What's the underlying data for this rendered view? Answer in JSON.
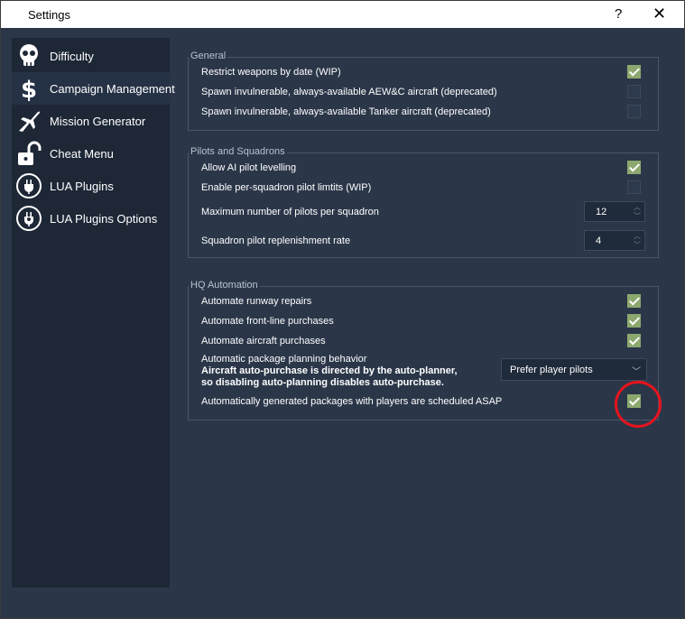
{
  "window": {
    "title": "Settings",
    "help_label": "?",
    "close_label": "✕"
  },
  "sidebar": {
    "items": [
      {
        "label": "Difficulty",
        "icon": "skull-icon"
      },
      {
        "label": "Campaign Management",
        "icon": "dollar-icon"
      },
      {
        "label": "Mission Generator",
        "icon": "jet-icon"
      },
      {
        "label": "Cheat Menu",
        "icon": "unlock-icon"
      },
      {
        "label": "LUA Plugins",
        "icon": "plug-icon"
      },
      {
        "label": "LUA Plugins Options",
        "icon": "plug-settings-icon"
      }
    ],
    "selected_index": 1
  },
  "general": {
    "title": "General",
    "rows": [
      {
        "label": "Restrict weapons by date (WIP)",
        "checked": true
      },
      {
        "label": "Spawn invulnerable, always-available AEW&C aircraft (deprecated)",
        "checked": false
      },
      {
        "label": "Spawn invulnerable, always-available Tanker aircraft (deprecated)",
        "checked": false
      }
    ]
  },
  "pilots": {
    "title": "Pilots and Squadrons",
    "rows": [
      {
        "label": "Allow AI pilot levelling",
        "checked": true
      },
      {
        "label": "Enable per-squadron pilot limtits (WIP)",
        "checked": false
      }
    ],
    "max_pilots": {
      "label": "Maximum number of pilots per squadron",
      "value": "12"
    },
    "replenish": {
      "label": "Squadron pilot replenishment rate",
      "value": "4"
    }
  },
  "hq": {
    "title": "HQ Automation",
    "rows": [
      {
        "label": "Automate runway repairs",
        "checked": true
      },
      {
        "label": "Automate front-line purchases",
        "checked": true
      },
      {
        "label": "Automate aircraft purchases",
        "checked": true
      }
    ],
    "planning": {
      "label": "Automatic package planning behavior",
      "note_line1": "Aircraft auto-purchase is directed by the auto-planner,",
      "note_line2": "so disabling auto-planning disables auto-purchase.",
      "selected": "Prefer player pilots"
    },
    "asap": {
      "label": "Automatically generated packages with players are scheduled ASAP",
      "checked": true
    }
  },
  "colors": {
    "accent_check": "#8ca86f",
    "annotation": "#e8131d"
  }
}
